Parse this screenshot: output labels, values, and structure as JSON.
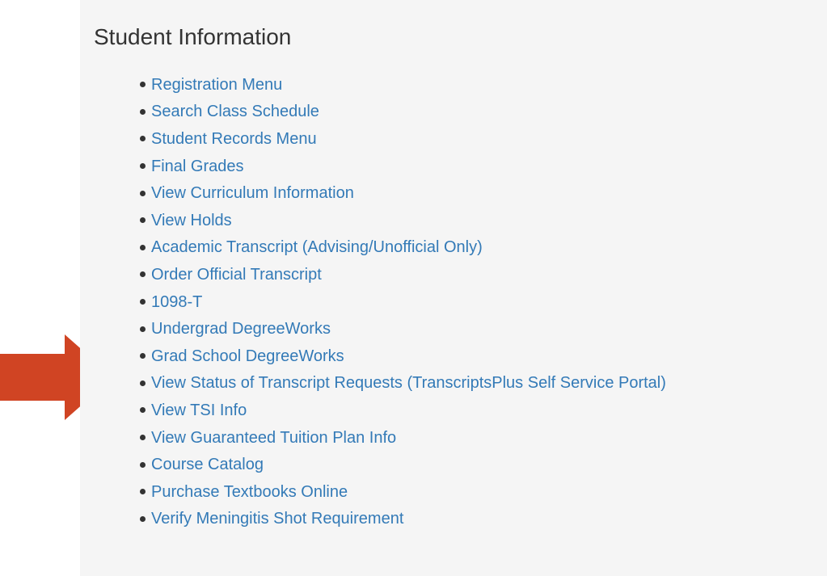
{
  "panel": {
    "title": "Student Information",
    "links": [
      "Registration Menu",
      "Search Class Schedule",
      "Student Records Menu",
      "Final Grades",
      "View Curriculum Information",
      "View Holds",
      "Academic Transcript (Advising/Unofficial Only)",
      "Order Official Transcript",
      "1098-T",
      "Undergrad DegreeWorks",
      "Grad School DegreeWorks",
      "View Status of Transcript Requests (TranscriptsPlus Self Service Portal)",
      "View TSI Info",
      "View Guaranteed Tuition Plan Info",
      "Course Catalog",
      "Purchase Textbooks Online",
      "Verify Meningitis Shot Requirement"
    ]
  },
  "annotation": {
    "arrow_color": "#d04423",
    "arrow_icon": "arrow-right-icon"
  },
  "colors": {
    "link": "#337ab7",
    "panel_background": "#f5f5f5",
    "title": "#333333"
  }
}
